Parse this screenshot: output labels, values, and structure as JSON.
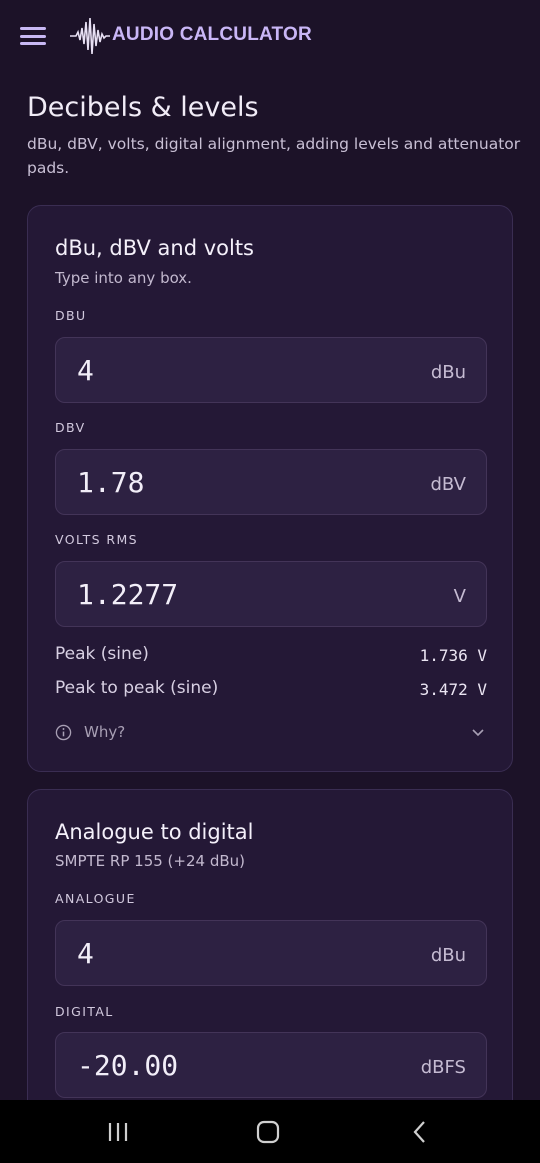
{
  "app": {
    "title": "AUDIO CALCULATOR"
  },
  "page": {
    "title": "Decibels & levels",
    "subtitle": "dBu, dBV, volts, digital alignment, adding levels and attenuator pads."
  },
  "card1": {
    "title": "dBu, dBV and volts",
    "subtitle": "Type into any box.",
    "fields": [
      {
        "label": "DBU",
        "value": "4",
        "unit": "dBu"
      },
      {
        "label": "DBV",
        "value": "1.78",
        "unit": "dBV"
      },
      {
        "label": "VOLTS RMS",
        "value": "1.2277",
        "unit": "V"
      }
    ],
    "rows": [
      {
        "key": "Peak (sine)",
        "value": "1.736 V"
      },
      {
        "key": "Peak to peak (sine)",
        "value": "3.472 V"
      }
    ],
    "why_label": "Why?"
  },
  "card2": {
    "title": "Analogue to digital",
    "subtitle": "SMPTE RP 155 (+24 dBu)",
    "fields": [
      {
        "label": "ANALOGUE",
        "value": "4",
        "unit": "dBu"
      },
      {
        "label": "DIGITAL",
        "value": "-20.00",
        "unit": "dBFS"
      }
    ]
  },
  "icons": {
    "menu": "menu-icon",
    "logo": "waveform-logo-icon",
    "info": "info-icon",
    "expand": "chevron-down-icon",
    "recents": "recents-icon",
    "home": "home-icon",
    "back": "back-icon"
  },
  "colors": {
    "background": "#1c1228",
    "card": "#241836",
    "field": "#2d2142",
    "accent": "#c9b6f6"
  }
}
